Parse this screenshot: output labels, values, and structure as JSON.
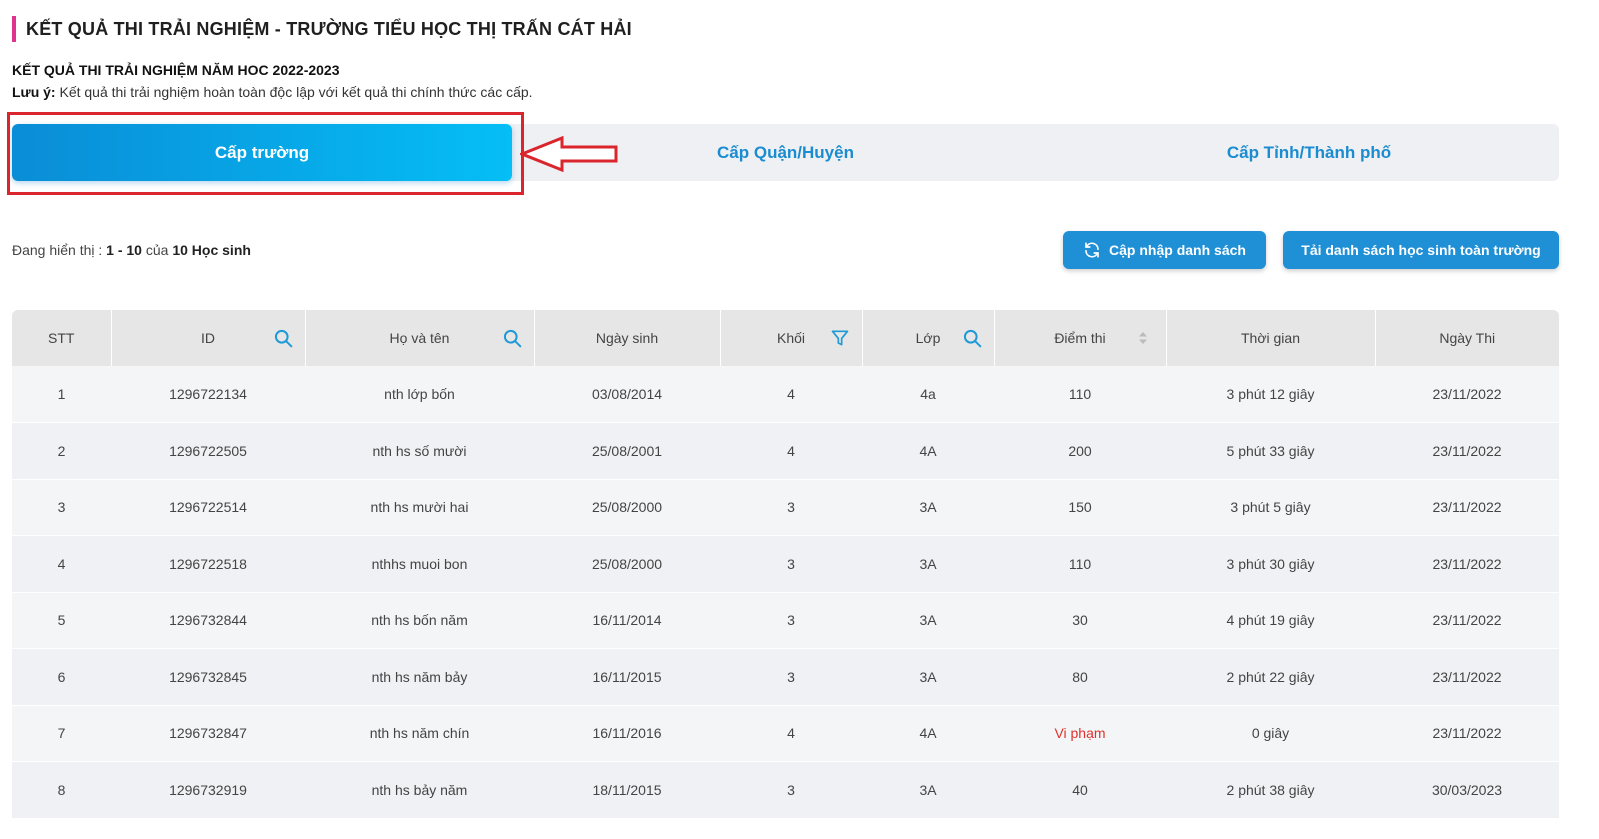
{
  "page": {
    "title": "KẾT QUẢ THI TRẢI NGHIỆM - TRƯỜNG TIỂU HỌC THỊ TRẤN CÁT HẢI",
    "subtitle": "KẾT QUẢ THI TRẢI NGHIỆM NĂM HOC 2022-2023",
    "note_label": "Lưu ý:",
    "note_text": " Kết quả thi trải nghiệm hoàn toàn độc lập với kết quả thi chính thức các cấp."
  },
  "tabs": [
    {
      "label": "Cấp trường",
      "active": true
    },
    {
      "label": "Cấp Quận/Huyện",
      "active": false
    },
    {
      "label": "Cấp Tỉnh/Thành phố",
      "active": false
    }
  ],
  "status": {
    "prefix": "Đang hiển thị : ",
    "range": "1 - 10",
    "of": " của ",
    "total": "10 Học sinh"
  },
  "buttons": {
    "refresh": "Cập nhập danh sách",
    "download": "Tải danh sách học sinh toàn trường"
  },
  "columns": [
    "STT",
    "ID",
    "Họ và tên",
    "Ngày sinh",
    "Khối",
    "Lớp",
    "Điểm thi",
    "Thời gian",
    "Ngày Thi"
  ],
  "rows": [
    {
      "stt": "1",
      "id": "1296722134",
      "name": "nth lớp bốn",
      "dob": "03/08/2014",
      "grade": "4",
      "class": "4a",
      "score": "110",
      "time": "3 phút 12 giây",
      "date": "23/11/2022"
    },
    {
      "stt": "2",
      "id": "1296722505",
      "name": "nth hs số mười",
      "dob": "25/08/2001",
      "grade": "4",
      "class": "4A",
      "score": "200",
      "time": "5 phút 33 giây",
      "date": "23/11/2022"
    },
    {
      "stt": "3",
      "id": "1296722514",
      "name": "nth hs mười hai",
      "dob": "25/08/2000",
      "grade": "3",
      "class": "3A",
      "score": "150",
      "time": "3 phút 5 giây",
      "date": "23/11/2022"
    },
    {
      "stt": "4",
      "id": "1296722518",
      "name": "nthhs muoi bon",
      "dob": "25/08/2000",
      "grade": "3",
      "class": "3A",
      "score": "110",
      "time": "3 phút 30 giây",
      "date": "23/11/2022"
    },
    {
      "stt": "5",
      "id": "1296732844",
      "name": "nth hs bốn năm",
      "dob": "16/11/2014",
      "grade": "3",
      "class": "3A",
      "score": "30",
      "time": "4 phút 19 giây",
      "date": "23/11/2022"
    },
    {
      "stt": "6",
      "id": "1296732845",
      "name": "nth hs năm bảy",
      "dob": "16/11/2015",
      "grade": "3",
      "class": "3A",
      "score": "80",
      "time": "2 phút 22 giây",
      "date": "23/11/2022"
    },
    {
      "stt": "7",
      "id": "1296732847",
      "name": "nth hs năm chín",
      "dob": "16/11/2016",
      "grade": "4",
      "class": "4A",
      "score": "Vi phạm",
      "time": "0 giây",
      "date": "23/11/2022"
    },
    {
      "stt": "8",
      "id": "1296732919",
      "name": "nth hs bảy năm",
      "dob": "18/11/2015",
      "grade": "3",
      "class": "3A",
      "score": "40",
      "time": "2 phút 38 giây",
      "date": "30/03/2023"
    }
  ],
  "colors": {
    "accent": "#1f8fd6",
    "tab_gradient_start": "#0a8dd6",
    "tab_gradient_end": "#05bef5",
    "violation": "#e0322c",
    "annotation": "#d9252b"
  }
}
